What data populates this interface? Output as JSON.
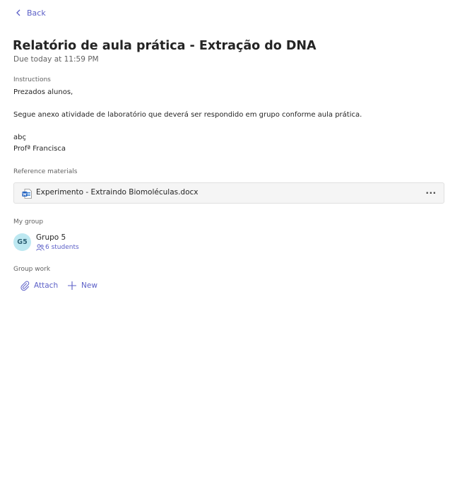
{
  "nav": {
    "back_label": "Back"
  },
  "assignment": {
    "title": "Relatório de aula prática - Extração do DNA",
    "due": "Due today at 11:59 PM"
  },
  "instructions": {
    "label": "Instructions",
    "lines": [
      "Prezados alunos,",
      "Segue anexo atividade de laboratório que deverá ser respondido em grupo conforme aula prática.",
      "abç",
      "Profª Francisca"
    ]
  },
  "reference": {
    "label": "Reference materials",
    "file_name": "Experimento - Extraindo Biomoléculas.docx",
    "file_icon": "word-doc-icon",
    "more_label": "···"
  },
  "group": {
    "label": "My group",
    "avatar_initials": "G5",
    "name": "Grupo 5",
    "students": "6 students",
    "avatar_color": "#bde8f1"
  },
  "group_work": {
    "label": "Group work",
    "attach_label": "Attach",
    "new_label": "New"
  },
  "colors": {
    "accent": "#5b5fc7",
    "text": "#242424",
    "muted": "#616161"
  }
}
